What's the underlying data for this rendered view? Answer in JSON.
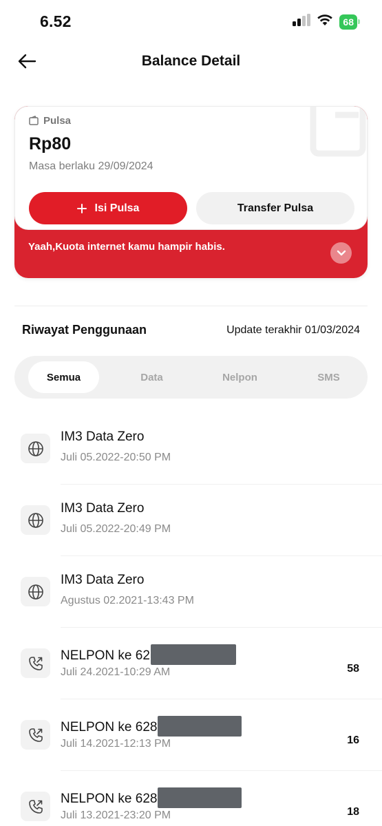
{
  "status_bar": {
    "time": "6.52",
    "battery": "68"
  },
  "header": {
    "title": "Balance Detail"
  },
  "balance_card": {
    "label": "Pulsa",
    "amount": "Rp80",
    "validity": "Masa berlaku 29/09/2024",
    "primary_button": "Isi Pulsa",
    "secondary_button": "Transfer Pulsa",
    "alert": "Yaah,Kuota internet kamu hampir habis.",
    "accent_color": "#e11d27"
  },
  "history": {
    "title": "Riwayat Penggunaan",
    "last_update": "Update terakhir 01/03/2024",
    "tabs": [
      {
        "label": "Semua",
        "active": true
      },
      {
        "label": "Data",
        "active": false
      },
      {
        "label": "Nelpon",
        "active": false
      },
      {
        "label": "SMS",
        "active": false
      }
    ],
    "items": [
      {
        "icon": "globe-icon",
        "title": "IM3 Data Zero",
        "date": "Juli 05.2022-20:50 PM",
        "value": ""
      },
      {
        "icon": "globe-icon",
        "title": "IM3 Data Zero",
        "date": "Juli 05.2022-20:49 PM",
        "value": ""
      },
      {
        "icon": "globe-icon",
        "title": "IM3 Data Zero",
        "date": "Agustus 02.2021-13:43 PM",
        "value": ""
      },
      {
        "icon": "phone-outgoing-icon",
        "title": "NELPON ke 62",
        "date": "Juli 24.2021-10:29 AM",
        "value": "58"
      },
      {
        "icon": "phone-outgoing-icon",
        "title": "NELPON ke 628",
        "date": "Juli 14.2021-12:13 PM",
        "value": "16"
      },
      {
        "icon": "phone-outgoing-icon",
        "title": "NELPON ke 628",
        "date": "Juli 13.2021-23:20 PM",
        "value": "18"
      }
    ]
  }
}
